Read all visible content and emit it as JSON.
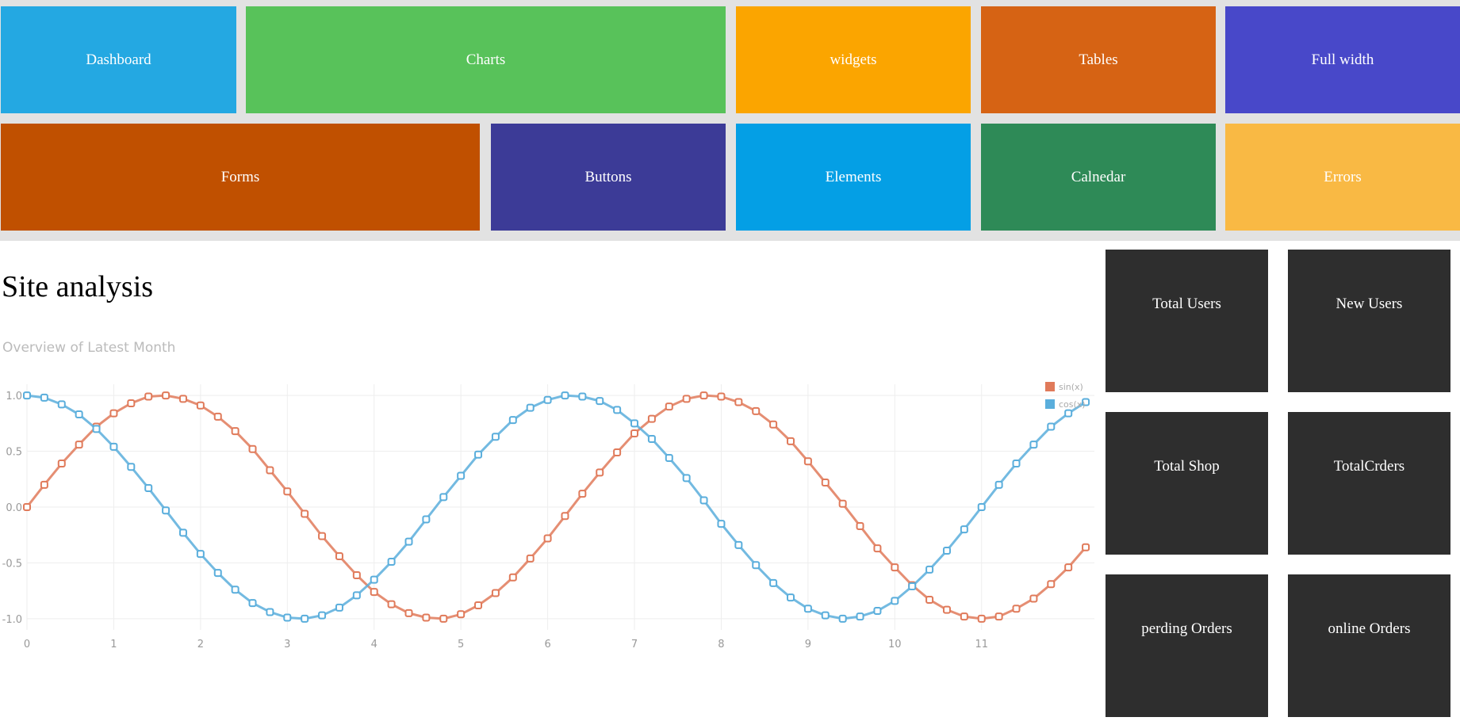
{
  "nav_row_1": [
    {
      "label": "Dashboard",
      "color": "#24a8e2"
    },
    {
      "label": "Charts",
      "color": "#58c25a"
    },
    {
      "label": "widgets",
      "color": "#fba500"
    },
    {
      "label": "Tables",
      "color": "#d66314"
    },
    {
      "label": "Full width",
      "color": "#4848c9"
    }
  ],
  "nav_row_2": [
    {
      "label": "Forms",
      "color": "#c05000"
    },
    {
      "label": "Buttons",
      "color": "#3c3b97"
    },
    {
      "label": "Elements",
      "color": "#049fe5"
    },
    {
      "label": "Calnedar",
      "color": "#2e8a57"
    },
    {
      "label": "Errors",
      "color": "#f9b944"
    }
  ],
  "page_title": "Site analysis",
  "chart_data": {
    "type": "line",
    "title": "",
    "subtitle": "Overview of Latest Month",
    "xlabel": "",
    "ylabel": "",
    "xlim": [
      0,
      12.3
    ],
    "ylim": [
      -1.1,
      1.1
    ],
    "x_ticks": [
      0,
      1,
      2,
      3,
      4,
      5,
      6,
      7,
      8,
      9,
      10,
      11
    ],
    "y_ticks": [
      "1.0",
      "0.5",
      "0.0",
      "-0.5",
      "-1.0"
    ],
    "grid": true,
    "legend_position": "top-right",
    "x": [
      0,
      0.2,
      0.4,
      0.6,
      0.8,
      1,
      1.2,
      1.4,
      1.6,
      1.8,
      2,
      2.2,
      2.4,
      2.6,
      2.8,
      3,
      3.2,
      3.4,
      3.6,
      3.8,
      4,
      4.2,
      4.4,
      4.6,
      4.8,
      5,
      5.2,
      5.4,
      5.6,
      5.8,
      6,
      6.2,
      6.4,
      6.6,
      6.8,
      7,
      7.2,
      7.4,
      7.6,
      7.8,
      8,
      8.2,
      8.4,
      8.6,
      8.8,
      9,
      9.2,
      9.4,
      9.6,
      9.8,
      10,
      10.2,
      10.4,
      10.6,
      10.8,
      11,
      11.2,
      11.4,
      11.6,
      11.8,
      12,
      12.2
    ],
    "series": [
      {
        "name": "sin(x)",
        "color": "#e07a5a",
        "values": [
          0,
          0.2,
          0.39,
          0.56,
          0.72,
          0.84,
          0.93,
          0.99,
          1,
          0.97,
          0.91,
          0.81,
          0.68,
          0.52,
          0.33,
          0.14,
          -0.06,
          -0.26,
          -0.44,
          -0.61,
          -0.76,
          -0.87,
          -0.95,
          -0.99,
          -1,
          -0.96,
          -0.88,
          -0.77,
          -0.63,
          -0.46,
          -0.28,
          -0.08,
          0.12,
          0.31,
          0.49,
          0.66,
          0.79,
          0.9,
          0.97,
          1,
          0.99,
          0.94,
          0.86,
          0.74,
          0.59,
          0.41,
          0.22,
          0.03,
          -0.17,
          -0.37,
          -0.54,
          -0.7,
          -0.83,
          -0.92,
          -0.98,
          -1,
          -0.98,
          -0.91,
          -0.82,
          -0.69,
          -0.54,
          -0.36
        ]
      },
      {
        "name": "cos(x)",
        "color": "#5aaedc",
        "values": [
          1,
          0.98,
          0.92,
          0.83,
          0.7,
          0.54,
          0.36,
          0.17,
          -0.03,
          -0.23,
          -0.42,
          -0.59,
          -0.74,
          -0.86,
          -0.94,
          -0.99,
          -1,
          -0.97,
          -0.9,
          -0.79,
          -0.65,
          -0.49,
          -0.31,
          -0.11,
          0.09,
          0.28,
          0.47,
          0.63,
          0.78,
          0.89,
          0.96,
          1,
          0.99,
          0.95,
          0.87,
          0.75,
          0.61,
          0.44,
          0.26,
          0.06,
          -0.15,
          -0.34,
          -0.52,
          -0.68,
          -0.81,
          -0.91,
          -0.97,
          -1,
          -0.98,
          -0.93,
          -0.84,
          -0.71,
          -0.56,
          -0.39,
          -0.2,
          0,
          0.2,
          0.39,
          0.56,
          0.72,
          0.84,
          0.94
        ]
      }
    ]
  },
  "stats": [
    {
      "label": "Total Users"
    },
    {
      "label": "New Users"
    },
    {
      "label": "Total Shop"
    },
    {
      "label": "TotalCrders"
    },
    {
      "label": "perding Orders"
    },
    {
      "label": "online Orders"
    }
  ]
}
